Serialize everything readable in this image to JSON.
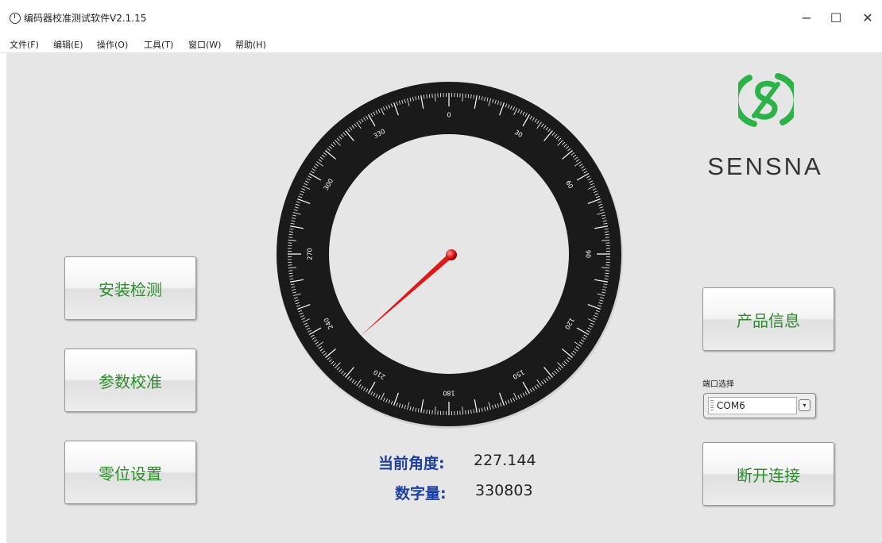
{
  "window": {
    "title": "编码器校准测试软件V2.1.15",
    "minimize": "−",
    "maximize": "☐",
    "close": "✕"
  },
  "menu": [
    "文件(F)",
    "编辑(E)",
    "操作(O)",
    "工具(T)",
    "窗口(W)",
    "帮助(H)"
  ],
  "buttons": {
    "install_check": "安装检测",
    "param_calibrate": "参数校准",
    "zero_setting": "零位设置",
    "product_info": "产品信息",
    "disconnect": "断开连接"
  },
  "logo": {
    "text": "SENSNA",
    "accent": "#2db24a"
  },
  "gauge": {
    "labels": [
      "0",
      "30",
      "60",
      "90",
      "120",
      "150",
      "180",
      "210",
      "240",
      "270",
      "300",
      "330"
    ],
    "needle_angle_deg": 227.144,
    "needle_color": "#e01818"
  },
  "readout": {
    "angle_label": "当前角度:",
    "angle_value": "227.144",
    "count_label": "数字量:",
    "count_value": "330803"
  },
  "port": {
    "label": "端口选择",
    "value": "COM6"
  }
}
